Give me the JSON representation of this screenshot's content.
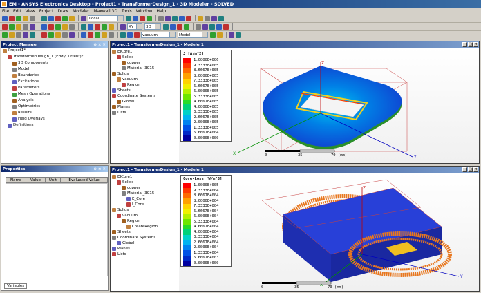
{
  "title": "EM - ANSYS Electronics Desktop - Project1 - TransformerDesign_1 - 3D Modeler - SOLVED",
  "menu": [
    "File",
    "Edit",
    "View",
    "Project",
    "Draw",
    "Modeler",
    "Maxwell 3D",
    "Tools",
    "Window",
    "Help"
  ],
  "toolbar": {
    "cs": "Local",
    "plane": "XY",
    "dim": "3D",
    "material": "vacuum",
    "mode": "Model"
  },
  "project_manager": {
    "title": "Project Manager",
    "items": [
      {
        "label": "Project1*",
        "level": 0
      },
      {
        "label": "TransformerDesign_1 (EddyCurrent)*",
        "level": 1
      },
      {
        "label": "3D Components",
        "level": 2
      },
      {
        "label": "Model",
        "level": 2
      },
      {
        "label": "Boundaries",
        "level": 2
      },
      {
        "label": "Excitations",
        "level": 2
      },
      {
        "label": "Parameters",
        "level": 2
      },
      {
        "label": "Mesh Operations",
        "level": 2
      },
      {
        "label": "Analysis",
        "level": 2
      },
      {
        "label": "Optimetrics",
        "level": 2
      },
      {
        "label": "Results",
        "level": 2
      },
      {
        "label": "Field Overlays",
        "level": 2
      },
      {
        "label": "Definitions",
        "level": 1
      }
    ]
  },
  "properties": {
    "title": "Properties",
    "columns": [
      "Name",
      "Value",
      "Unit",
      "Evaluated Value"
    ],
    "tab": "Variables"
  },
  "window1": {
    "title": "Project1 - TransformerDesign_1 - Modeler1",
    "tree": [
      {
        "label": "EICore1",
        "level": 0
      },
      {
        "label": "Solids",
        "level": 1
      },
      {
        "label": "copper",
        "level": 2
      },
      {
        "label": "Material_3C15",
        "level": 2
      },
      {
        "label": "Solids",
        "level": 0
      },
      {
        "label": "vacuum",
        "level": 1
      },
      {
        "label": "Region",
        "level": 2
      },
      {
        "label": "Sheets",
        "level": 0
      },
      {
        "label": "Coordinate Systems",
        "level": 0
      },
      {
        "label": "Global",
        "level": 1
      },
      {
        "label": "Planes",
        "level": 0
      },
      {
        "label": "Lists",
        "level": 0
      }
    ],
    "legend_title": "J [A/m^2]",
    "legend_values": [
      "1.0000E+006",
      "9.3333E+005",
      "8.6667E+005",
      "8.0000E+005",
      "7.3333E+005",
      "6.6667E+005",
      "6.0000E+005",
      "5.3333E+005",
      "4.6667E+005",
      "4.0000E+005",
      "3.3333E+005",
      "2.6667E+005",
      "2.0000E+005",
      "1.3333E+005",
      "6.6667E+004",
      "0.0000E+000"
    ],
    "scale": [
      "0",
      "35",
      "70 (mm)"
    ]
  },
  "window2": {
    "title": "Project1 - TransformerDesign_1 - Modeler1",
    "tree": [
      {
        "label": "EICore1",
        "level": 0
      },
      {
        "label": "Solids",
        "level": 1
      },
      {
        "label": "copper",
        "level": 2
      },
      {
        "label": "Material_3C15",
        "level": 2
      },
      {
        "label": "E_Core",
        "level": 3
      },
      {
        "label": "I_Core",
        "level": 3
      },
      {
        "label": "Solids",
        "level": 0
      },
      {
        "label": "vacuum",
        "level": 1
      },
      {
        "label": "Region",
        "level": 2
      },
      {
        "label": "CreateRegion",
        "level": 3
      },
      {
        "label": "Sheets",
        "level": 0
      },
      {
        "label": "Coordinate Systems",
        "level": 0
      },
      {
        "label": "Global",
        "level": 1
      },
      {
        "label": "Planes",
        "level": 0
      },
      {
        "label": "Lists",
        "level": 0
      }
    ],
    "legend_title": "Core-Loss [W/m^3]",
    "legend_values": [
      "1.0000E+005",
      "9.3333E+004",
      "8.6667E+004",
      "8.0000E+004",
      "7.3333E+004",
      "6.6667E+004",
      "6.0000E+004",
      "5.3333E+004",
      "4.6667E+004",
      "4.0000E+004",
      "3.3333E+004",
      "2.6667E+004",
      "2.0000E+004",
      "1.3333E+004",
      "6.6667E+003",
      "0.0000E+000"
    ],
    "scale": [
      "0",
      "35",
      "70 (mm)"
    ]
  },
  "legend_colors": [
    "#ff0000",
    "#ff3800",
    "#ff6a00",
    "#ffa000",
    "#ffd200",
    "#f0f000",
    "#b4f000",
    "#6ee600",
    "#28dc28",
    "#00d278",
    "#00d2c8",
    "#00b4f0",
    "#0082f0",
    "#0050e6",
    "#0028c8",
    "#0000a0"
  ]
}
